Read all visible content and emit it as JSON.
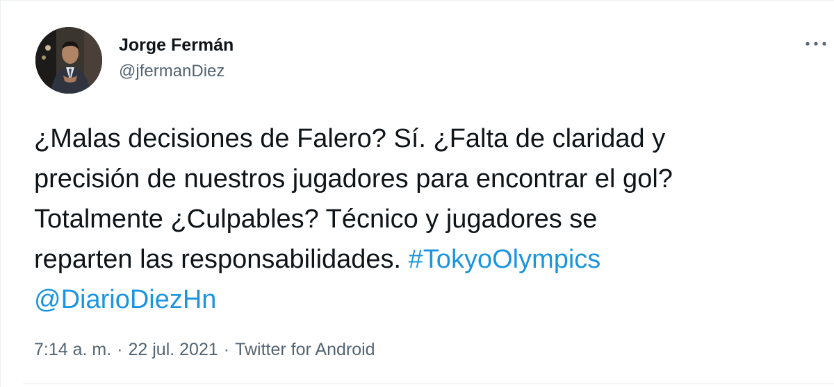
{
  "tweet": {
    "author": {
      "display_name": "Jorge Fermán",
      "handle": "@jfermanDiez"
    },
    "text_lines": [
      "¿Malas decisiones de Falero? Sí. ¿Falta de claridad y",
      "precisión de nuestros jugadores para encontrar el gol?",
      "Totalmente ¿Culpables? Técnico y jugadores se",
      "reparten las responsabilidades. "
    ],
    "hashtag": "#TokyoOlympics",
    "mention": "@DiarioDiezHn",
    "time": "7:14 a. m.",
    "separator": "·",
    "date": "22 jul. 2021",
    "source": "Twitter for Android",
    "more_icon": "more-horizontal-icon"
  },
  "colors": {
    "text": "#0f1419",
    "secondary": "#536471",
    "link": "#1b95e0"
  }
}
